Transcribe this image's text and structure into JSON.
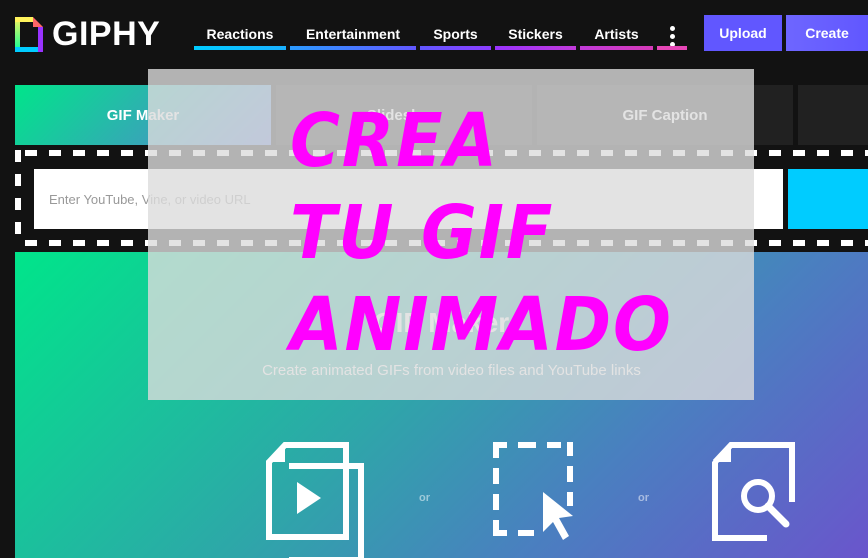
{
  "header": {
    "logo_text": "GIPHY",
    "nav": [
      {
        "label": "Reactions",
        "color_from": "#00ccff",
        "color_to": "#1ab0ff"
      },
      {
        "label": "Entertainment",
        "color_from": "#2b9bff",
        "color_to": "#6157ff"
      },
      {
        "label": "Sports",
        "color_from": "#6157ff",
        "color_to": "#8c3dff"
      },
      {
        "label": "Stickers",
        "color_from": "#9933ff",
        "color_to": "#c13ad9"
      },
      {
        "label": "Artists",
        "color_from": "#c13ad9",
        "color_to": "#d63ab8"
      }
    ],
    "more_color": "#e646b6",
    "upload_label": "Upload",
    "create_label": "Create"
  },
  "tabs": [
    {
      "label": "GIF Maker",
      "active": true
    },
    {
      "label": "Slideshow",
      "active": false
    },
    {
      "label": "GIF Caption",
      "active": false
    },
    {
      "label": "",
      "active": false
    }
  ],
  "url_input": {
    "placeholder": "Enter YouTube, Vine, or video URL",
    "value": ""
  },
  "main": {
    "title": "GIF Maker",
    "subtitle": "Create animated GIFs from video files and YouTube links",
    "or_label": "or",
    "options": [
      {
        "icon": "video-files-icon"
      },
      {
        "icon": "drag-drop-icon"
      },
      {
        "icon": "browse-file-icon"
      }
    ]
  },
  "overlay": {
    "lines": [
      "CREA",
      "TU GIF",
      "ANIMADO"
    ],
    "color": "#ff00ff"
  }
}
